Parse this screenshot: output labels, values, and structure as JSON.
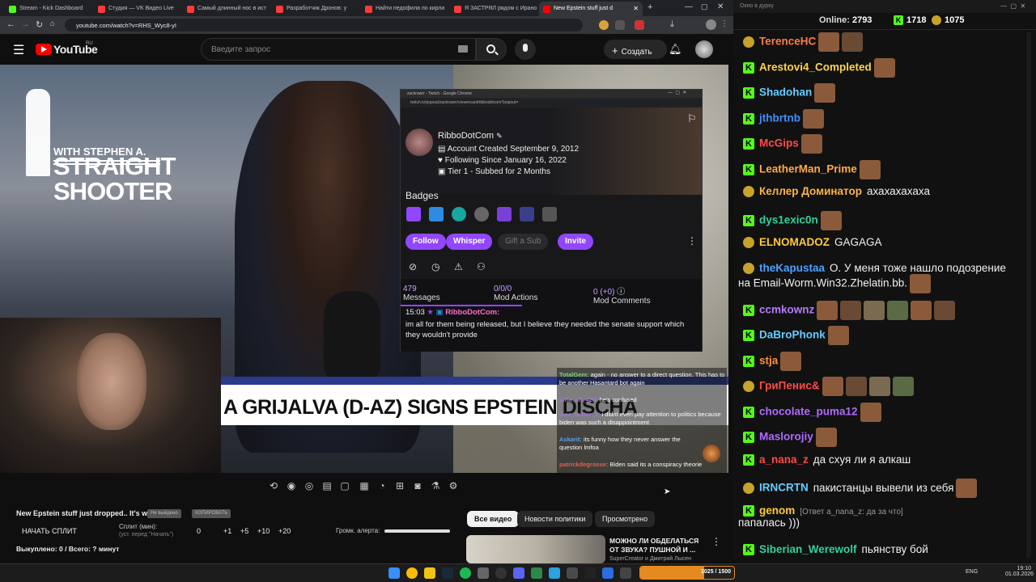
{
  "browser": {
    "tabs": [
      "Stream - Kick Dashboard",
      "Студия — VK Видео Live",
      "Самый длинный нос в ист",
      "Разработчик Дронов: у",
      "Найти педофила по кирли",
      "Я ЗАСТРЯЛ рядом с Ирано",
      "New Epstein stuff just d"
    ],
    "active_tab": 6,
    "url": "youtube.com/watch?v=RHS_Wyc8-yI"
  },
  "youtube": {
    "logo": "YouTube",
    "region": "RU",
    "search_placeholder": "Введите запрос",
    "create_label": "Создать"
  },
  "video": {
    "logo_line1": "STRAIGHT",
    "logo_line2": "SHOOTER",
    "logo_line3": "WITH STEPHEN A.",
    "banner_text": "A GRIJALVA (D-AZ) SIGNS EPSTEIN DISCHA"
  },
  "popup": {
    "window_title": "zackrawrr - Twitch - Google Chrome",
    "url": "twitch.tv/popout/zackrawrr/viewercard/ribbodotcom?popout=",
    "username": "RibboDotCom",
    "created": "Account Created September 9, 2012",
    "following": "Following Since January 16, 2022",
    "tier": "Tier 1 - Subbed for 2 Months",
    "badges_label": "Badges",
    "buttons": [
      "Follow",
      "Whisper",
      "Gift a Sub",
      "Invite"
    ],
    "stats": [
      {
        "value": "479",
        "label": "Messages"
      },
      {
        "value": "0/0/0",
        "label": "Mod Actions"
      },
      {
        "value": "0 (+0)",
        "label": "Mod Comments"
      }
    ],
    "message_time": "15:03",
    "message_user": "RibboDotCom:",
    "message_text": "im all for them being released, but I believe they needed the senate support which they wouldn't provide"
  },
  "overlay_chat": [
    {
      "user": "TotalGem:",
      "text": "again - no answer to a direct question. This has to be another Hasantard bot again",
      "color": "#7fd37f"
    },
    {
      "user": "jaffa_alt_420:",
      "text": "he's confused",
      "color": "#b070e0"
    },
    {
      "user": "jose_tester_2:",
      "text": "i didnt even pay attention to politics because biden was such a disappointment",
      "color": "#a070f0"
    },
    {
      "user": "Askarit:",
      "text": "its funny how they never answer the question lmfoa",
      "color": "#5a9ff0"
    },
    {
      "user": "patrickdegrosse:",
      "text": "Biden said its a conspiracy theorie",
      "color": "#e06050"
    }
  ],
  "below_video": {
    "title": "New Epstein stuff just dropped.. It's wild",
    "tag1": "Не выйдено",
    "tag2": "КОПИРОВАТЬ",
    "split_btn": "НАЧАТЬ СПЛИТ",
    "split_label": "Сплит (мин):",
    "split_hint": "(уст. перед \"Начать\")",
    "split_values": [
      "0",
      "+1",
      "+5",
      "+10",
      "+20"
    ],
    "volume_label": "Громк. алерта:",
    "volume": 1.0,
    "bought": "Выкуплено: 0 / Всего: ? минут"
  },
  "chips": [
    "Все видео",
    "Новости политики",
    "Просмотрено"
  ],
  "rec": {
    "title": "МОЖНО ЛИ ОБДЕЛАТЬСЯ ОТ ЗВУКА? ПУШНОЙ И ...",
    "channel": "SuperCreator и Дмитрий Лысен"
  },
  "taskbar": {
    "progress_label": "1025 / 1500",
    "lang": "ENG",
    "time": "19:10",
    "date": "01.03.2026"
  },
  "chat": {
    "window_title": "Окно в дурку",
    "online_label": "Online:",
    "online": "2793",
    "kick_count": "1718",
    "other_count": "1075",
    "messages": [
      {
        "user": "TerenceHC",
        "color": "#ff7a45",
        "text": "",
        "platform": "twitch",
        "emotes": 2
      },
      {
        "user": "Arestovi4_Completed",
        "color": "#ffd24a",
        "text": "",
        "platform": "kick",
        "emotes": 1
      },
      {
        "user": "Shadohan",
        "color": "#66ccff",
        "text": "",
        "platform": "kick",
        "emotes": 1
      },
      {
        "user": "jthbrtnb",
        "color": "#3f8cff",
        "text": "",
        "platform": "kick",
        "emotes": 1
      },
      {
        "user": "McGips",
        "color": "#ff4a4a",
        "text": "",
        "platform": "kick",
        "emotes": 1
      },
      {
        "user": "LeatherMan_Prime",
        "color": "#ffa94a",
        "text": "",
        "platform": "kick",
        "emotes": 1
      },
      {
        "user": "Келлер Доминатор",
        "color": "#ffb347",
        "text": "ахахахахаха",
        "platform": "twitch",
        "emotes": 0
      },
      {
        "user": "dys1exic0n",
        "color": "#33d0a0",
        "text": "",
        "platform": "kick",
        "emotes": 1
      },
      {
        "user": "ELNOMADOZ",
        "color": "#ffcc33",
        "text": "GAGAGA",
        "platform": "twitch",
        "emotes": 0
      },
      {
        "user": "theKapustaa",
        "color": "#4aa0ff",
        "text": "О. У меня тоже нашло подозрение",
        "text2": "на Email-Worm.Win32.Zhelatin.bb.",
        "platform": "twitch",
        "emotes": 1
      },
      {
        "user": "ccmkownz",
        "color": "#b57aff",
        "text": "",
        "platform": "kick",
        "emotes": 6
      },
      {
        "user": "DaBroPhonk",
        "color": "#66ccff",
        "text": "",
        "platform": "kick",
        "emotes": 1
      },
      {
        "user": "stja",
        "color": "#ff8c42",
        "text": "",
        "platform": "kick",
        "emotes": 1
      },
      {
        "user": "ГриПенис&",
        "color": "#ff4a4a",
        "text": "",
        "platform": "twitch",
        "emotes": 4
      },
      {
        "user": "chocolate_puma12",
        "color": "#b06aff",
        "text": "",
        "platform": "kick",
        "emotes": 1
      },
      {
        "user": "Maslorojiy",
        "color": "#b06aff",
        "text": "",
        "platform": "kick",
        "emotes": 1
      },
      {
        "user": "a_nana_z",
        "color": "#ff4a4a",
        "text": "да схуя ли я алкаш",
        "platform": "kick",
        "emotes": 0
      },
      {
        "user": "IRNCRTN",
        "color": "#66ccff",
        "text": "пакистанцы вывели из себя",
        "platform": "twitch",
        "emotes": 1
      },
      {
        "user": "genom",
        "color": "#ffcc33",
        "text": "[Ответ a_nana_z: да за что]",
        "text2": "папалась )))",
        "platform": "kick",
        "emotes": 0
      },
      {
        "user": "Siberian_Werewolf",
        "color": "#33d0a0",
        "text": "пьянству бой",
        "platform": "kick",
        "emotes": 0
      }
    ]
  },
  "colors": {
    "kick": "#53fc18",
    "twitch_purple": "#9147ff",
    "yt_red": "#ff0000"
  }
}
